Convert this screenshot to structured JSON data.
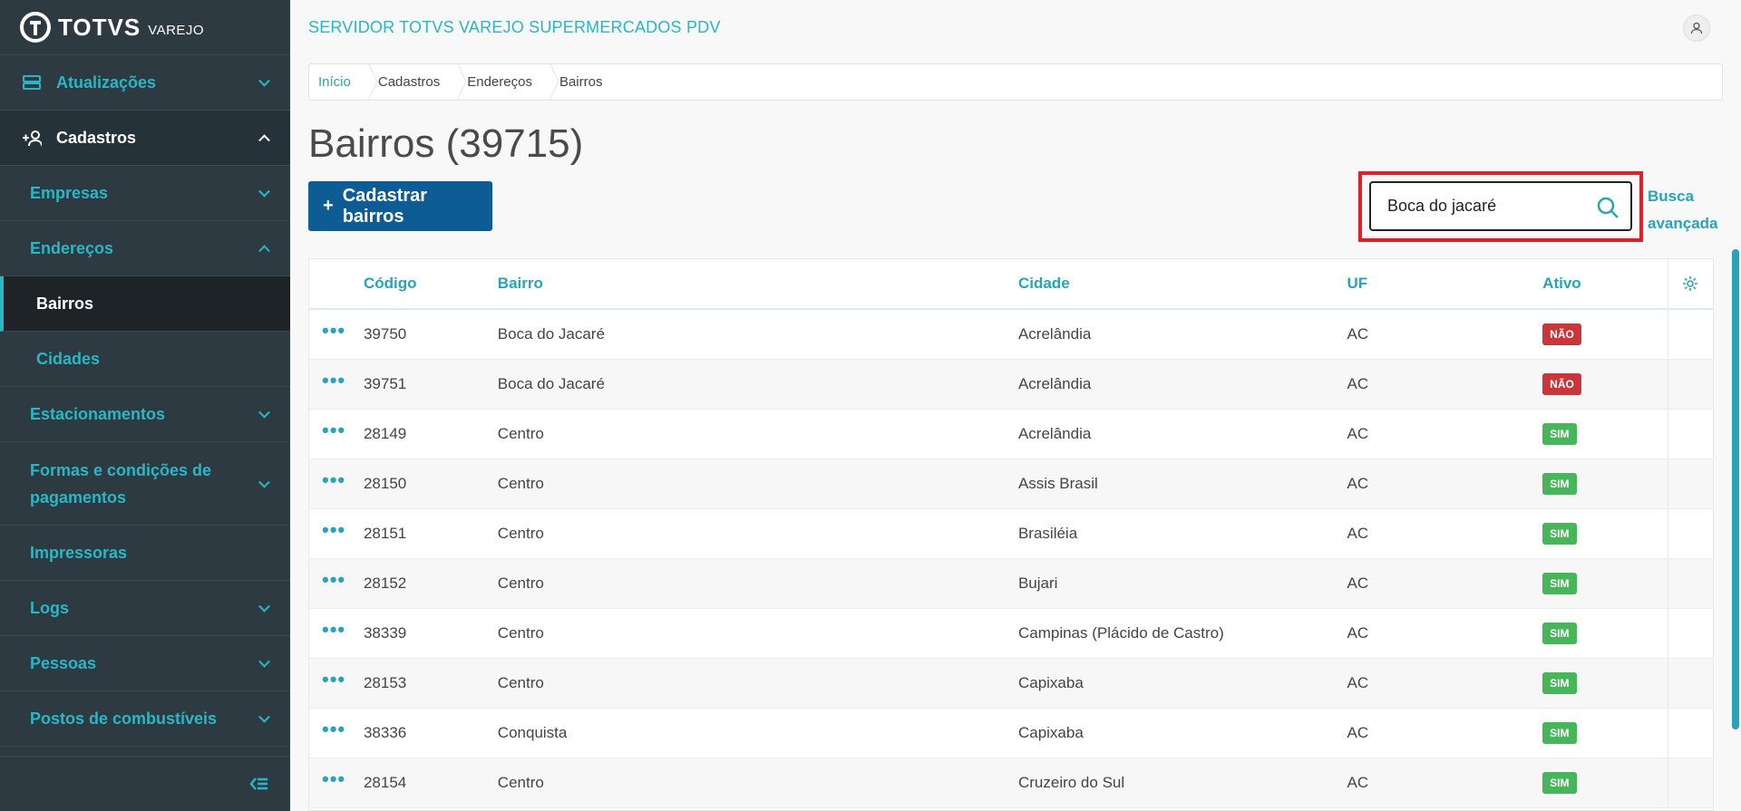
{
  "brand": {
    "name": "TOTVS",
    "sub": "VAREJO"
  },
  "topbar": {
    "title": "SERVIDOR TOTVS VAREJO SUPERMERCADOS PDV"
  },
  "sidebar": {
    "items": [
      {
        "label": "Atualizações"
      },
      {
        "label": "Cadastros"
      },
      {
        "label": "Empresas"
      },
      {
        "label": "Endereços"
      },
      {
        "label": "Bairros"
      },
      {
        "label": "Cidades"
      },
      {
        "label": "Estacionamentos"
      },
      {
        "label": "Formas e condições de pagamentos"
      },
      {
        "label": "Impressoras"
      },
      {
        "label": "Logs"
      },
      {
        "label": "Pessoas"
      },
      {
        "label": "Postos de combustíveis"
      }
    ]
  },
  "breadcrumb": [
    "Início",
    "Cadastros",
    "Endereços",
    "Bairros"
  ],
  "page": {
    "title": "Bairros (39715)"
  },
  "actions": {
    "add_label": "Cadastrar bairros",
    "add_plus": "+"
  },
  "search": {
    "value": "Boca do jacaré",
    "advanced_label": "Busca avançada"
  },
  "table": {
    "headers": {
      "codigo": "Código",
      "bairro": "Bairro",
      "cidade": "Cidade",
      "uf": "UF",
      "ativo": "Ativo"
    },
    "rows": [
      {
        "codigo": "39750",
        "bairro": "Boca do Jacaré",
        "cidade": "Acrelândia",
        "uf": "AC",
        "ativo": "NÃO"
      },
      {
        "codigo": "39751",
        "bairro": "Boca do Jacaré",
        "cidade": "Acrelândia",
        "uf": "AC",
        "ativo": "NÃO"
      },
      {
        "codigo": "28149",
        "bairro": "Centro",
        "cidade": "Acrelândia",
        "uf": "AC",
        "ativo": "SIM"
      },
      {
        "codigo": "28150",
        "bairro": "Centro",
        "cidade": "Assis Brasil",
        "uf": "AC",
        "ativo": "SIM"
      },
      {
        "codigo": "28151",
        "bairro": "Centro",
        "cidade": "Brasiléia",
        "uf": "AC",
        "ativo": "SIM"
      },
      {
        "codigo": "28152",
        "bairro": "Centro",
        "cidade": "Bujari",
        "uf": "AC",
        "ativo": "SIM"
      },
      {
        "codigo": "38339",
        "bairro": "Centro",
        "cidade": "Campinas (Plácido de Castro)",
        "uf": "AC",
        "ativo": "SIM"
      },
      {
        "codigo": "28153",
        "bairro": "Centro",
        "cidade": "Capixaba",
        "uf": "AC",
        "ativo": "SIM"
      },
      {
        "codigo": "38336",
        "bairro": "Conquista",
        "cidade": "Capixaba",
        "uf": "AC",
        "ativo": "SIM"
      },
      {
        "codigo": "28154",
        "bairro": "Centro",
        "cidade": "Cruzeiro do Sul",
        "uf": "AC",
        "ativo": "SIM"
      }
    ],
    "row_action": "•••"
  },
  "colors": {
    "accent": "#29b6c5",
    "primary": "#0d5c96",
    "danger": "#c9373b",
    "success": "#47b65a",
    "sidebar": "#2d3a42",
    "highlight": "#e41e26"
  }
}
